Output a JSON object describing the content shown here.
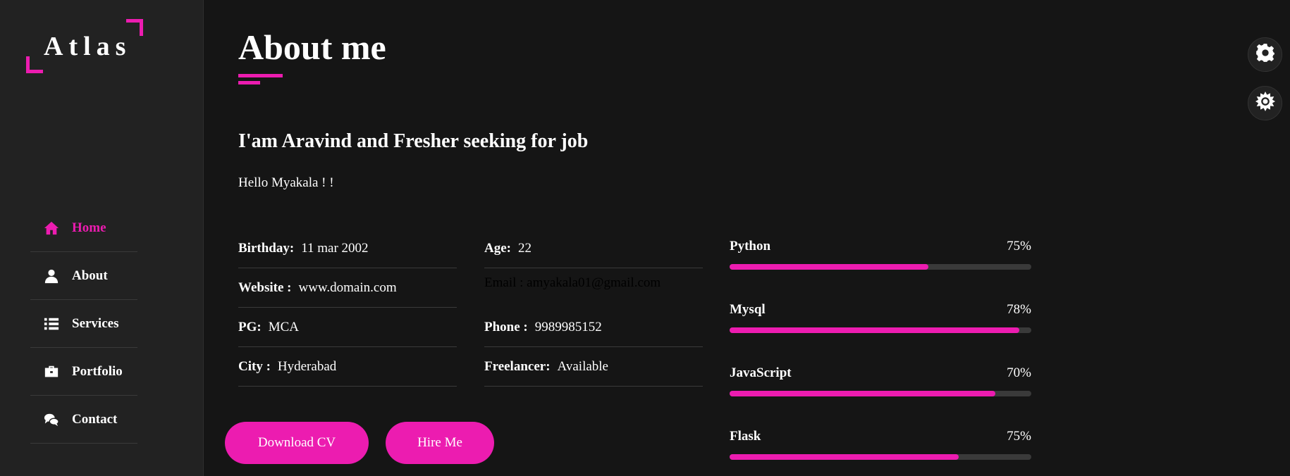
{
  "brand": {
    "name": "Atlas",
    "accent": "#ec1cb0"
  },
  "nav": [
    {
      "label": "Home",
      "icon": "home-icon",
      "active": true
    },
    {
      "label": "About",
      "icon": "user-icon",
      "active": false
    },
    {
      "label": "Services",
      "icon": "list-icon",
      "active": false
    },
    {
      "label": "Portfolio",
      "icon": "briefcase-icon",
      "active": false
    },
    {
      "label": "Contact",
      "icon": "chat-icon",
      "active": false
    }
  ],
  "about": {
    "title": "About me",
    "subtitle": "I'am Aravind and Fresher seeking for job",
    "greeting": "Hello Myakala ! !"
  },
  "info": {
    "birthday": {
      "label": "Birthday:",
      "value": "11 mar 2002"
    },
    "website": {
      "label": "Website :",
      "value": "www.domain.com"
    },
    "pg": {
      "label": "PG:",
      "value": "MCA"
    },
    "city": {
      "label": "City :",
      "value": "Hyderabad"
    },
    "age": {
      "label": "Age:",
      "value": "22"
    },
    "email": "Email : amyakala01@gmail.com",
    "phone": {
      "label": "Phone :",
      "value": "9989985152"
    },
    "freelancer": {
      "label": "Freelancer:",
      "value": "Available"
    }
  },
  "skills": [
    {
      "name": "Python",
      "percent_label": "75%",
      "fill": 0.66
    },
    {
      "name": "Mysql",
      "percent_label": "78%",
      "fill": 0.96
    },
    {
      "name": "JavaScript",
      "percent_label": "70%",
      "fill": 0.88
    },
    {
      "name": "Flask",
      "percent_label": "75%",
      "fill": 0.76
    }
  ],
  "buttons": {
    "download": "Download CV",
    "hire": "Hire Me"
  },
  "settings_icons": [
    "gear-icon",
    "sun-gear-icon"
  ]
}
